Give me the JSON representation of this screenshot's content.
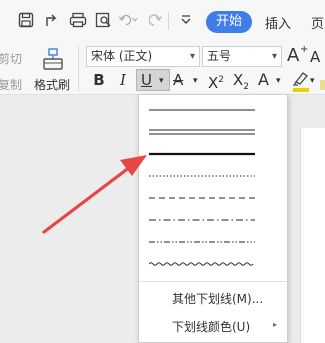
{
  "toolbar": {
    "tabs": {
      "start": "开始",
      "insert": "插入",
      "partial": "页"
    }
  },
  "ribbon": {
    "cut_label": "剪切",
    "copy_label": "复制",
    "format_painter_label": "格式刷",
    "font_name": "宋体 (正文)",
    "font_size": "五号",
    "bold": "B",
    "italic": "I",
    "underline": "U",
    "strikethrough": "A",
    "superscript_base": "X",
    "superscript_mark": "2",
    "subscript_base": "X",
    "subscript_mark": "2",
    "text_effect": "A",
    "grow_font": "A",
    "grow_font_mark": "+",
    "shrink_font": "A",
    "dropdown_arrow": "▾"
  },
  "underline_menu": {
    "line_styles": [
      "single",
      "double",
      "thick",
      "dotted",
      "dashed",
      "dash-dot",
      "dash-dot-dot",
      "wave"
    ],
    "more_underlines": "其他下划线(M)...",
    "underline_color": "下划线颜色(U)",
    "submenu_arrow": "▸"
  },
  "colors": {
    "accent": "#3f7de8",
    "annotation_arrow": "#e84545",
    "highlight": "#e8d200"
  }
}
